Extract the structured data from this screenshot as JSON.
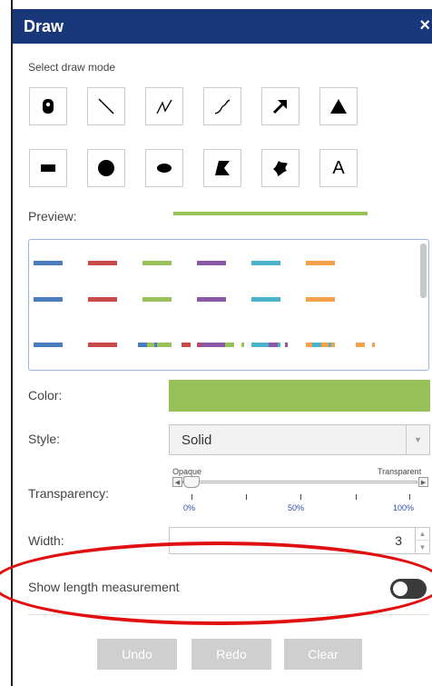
{
  "window": {
    "title": "Draw",
    "close_glyph": "×"
  },
  "draw_mode": {
    "label": "Select draw mode",
    "tools": [
      {
        "name": "point",
        "icon": "map-pin-icon"
      },
      {
        "name": "line",
        "icon": "line-icon"
      },
      {
        "name": "polyline",
        "icon": "polyline-icon"
      },
      {
        "name": "freehand-polyline",
        "icon": "freehand-line-icon"
      },
      {
        "name": "arrow",
        "icon": "arrow-icon"
      },
      {
        "name": "triangle",
        "icon": "triangle-icon"
      },
      {
        "name": "rectangle",
        "icon": "rectangle-icon"
      },
      {
        "name": "circle",
        "icon": "circle-icon"
      },
      {
        "name": "ellipse",
        "icon": "ellipse-icon"
      },
      {
        "name": "polygon",
        "icon": "polygon-icon"
      },
      {
        "name": "freehand-polygon",
        "icon": "freehand-polygon-icon"
      },
      {
        "name": "text",
        "icon": "text-icon",
        "glyph": "A"
      }
    ]
  },
  "preview": {
    "label": "Preview:",
    "color": "#98c15a"
  },
  "swatches": [
    {
      "color": "#4a7cc0",
      "style": "solid"
    },
    {
      "color": "#c94a4a",
      "style": "solid"
    },
    {
      "color": "#98c15a",
      "style": "solid"
    },
    {
      "color": "#8a5aa8",
      "style": "solid"
    },
    {
      "color": "#4bb4c8",
      "style": "solid"
    },
    {
      "color": "#f5a04b",
      "style": "solid"
    },
    {
      "color": "#4a7cc0",
      "style": "solid"
    },
    {
      "color": "#c94a4a",
      "style": "solid"
    },
    {
      "color": "#98c15a",
      "style": "solid"
    },
    {
      "color": "#8a5aa8",
      "style": "solid"
    },
    {
      "color": "#4bb4c8",
      "style": "solid"
    },
    {
      "color": "#f5a04b",
      "style": "solid"
    },
    {
      "color": "#4a7cc0",
      "style": "solid"
    },
    {
      "color": "#c94a4a",
      "style": "solid"
    },
    {
      "color": "#98c15a",
      "style": "solid"
    },
    {
      "color": "#8a5aa8",
      "style": "solid"
    },
    {
      "color": "#4bb4c8",
      "style": "solid"
    },
    {
      "color": "#f5a04b",
      "style": "solid"
    },
    {
      "color": "#4a7cc0",
      "style": "dashdot"
    },
    {
      "color": "#c94a4a",
      "style": "dashdot"
    },
    {
      "color": "#98c15a",
      "style": "dashdot"
    },
    {
      "color": "#8a5aa8",
      "style": "dashdot"
    },
    {
      "color": "#4bb4c8",
      "style": "dashdot"
    },
    {
      "color": "#f5a04b",
      "style": "dashdot"
    }
  ],
  "color": {
    "label": "Color:",
    "value": "#98c15a"
  },
  "style": {
    "label": "Style:",
    "value": "Solid"
  },
  "transparency": {
    "label": "Transparency:",
    "min_label": "Opaque",
    "max_label": "Transparent",
    "value_percent": 0,
    "ticks": [
      "0%",
      "50%",
      "100%"
    ]
  },
  "width": {
    "label": "Width:",
    "value": "3"
  },
  "length_measurement": {
    "label": "Show length measurement",
    "enabled": false
  },
  "buttons": {
    "undo": "Undo",
    "redo": "Redo",
    "clear": "Clear"
  },
  "accent_colors": {
    "titlebar": "#18387a",
    "annotation": "#e01010"
  }
}
